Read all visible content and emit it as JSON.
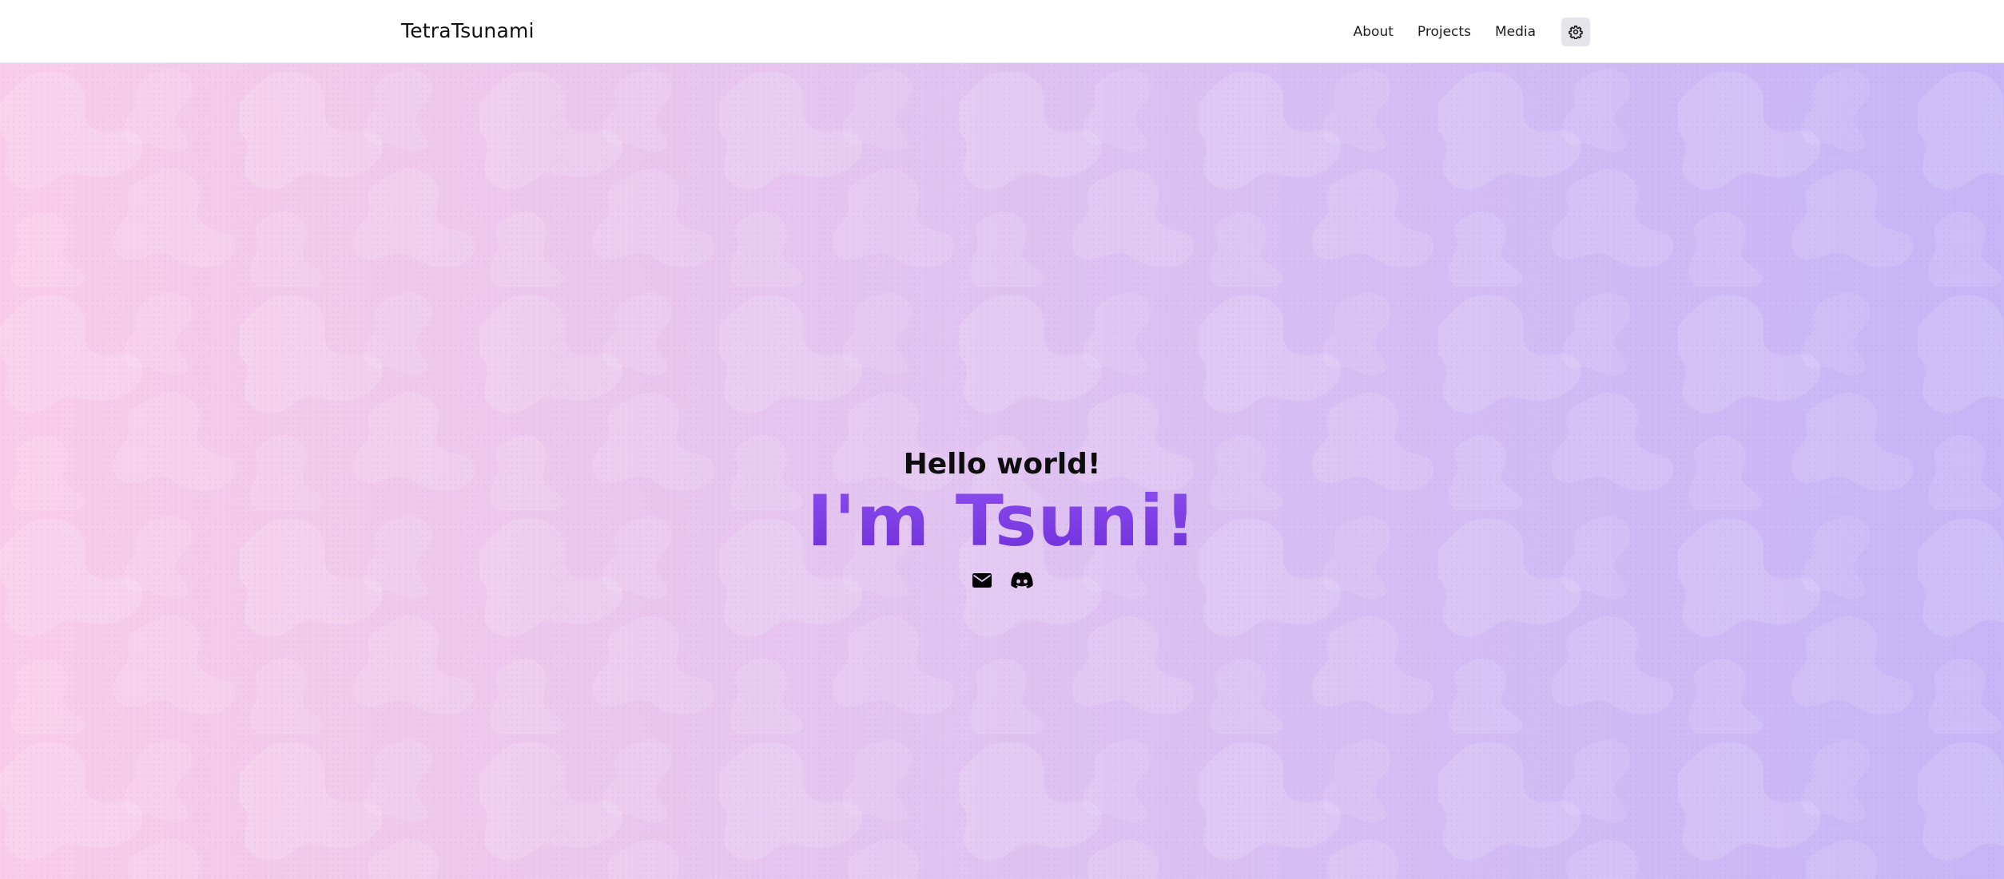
{
  "header": {
    "brand": "TetraTsunami",
    "nav": [
      {
        "label": "About"
      },
      {
        "label": "Projects"
      },
      {
        "label": "Media"
      }
    ],
    "theme_toggle_icon": "gear-icon"
  },
  "hero": {
    "greeting": "Hello world!",
    "title": "I'm Tsuni!",
    "socials": [
      {
        "icon": "mail-icon"
      },
      {
        "icon": "discord-icon"
      }
    ]
  },
  "colors": {
    "accent": "#7a3ae6",
    "gradient_left": "#f9cdea",
    "gradient_right": "#c6b5f7",
    "header_bg": "#ffffff",
    "text": "#0d0d0d"
  }
}
